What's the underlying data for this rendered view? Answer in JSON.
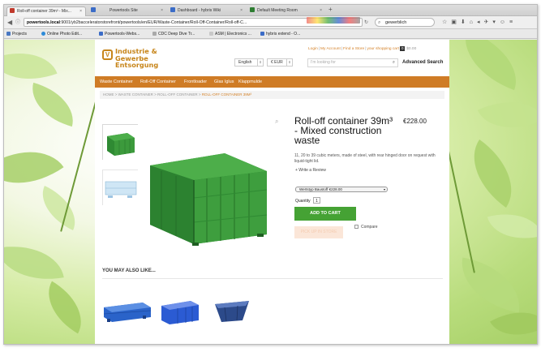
{
  "browser": {
    "tabs": [
      {
        "label": "Roll-off container 39m³ - Mix...",
        "icon_color": "#c0392b",
        "active": true
      },
      {
        "label": "Powertools Site",
        "icon_color": "#3b6cc7"
      },
      {
        "label": "Dashboard - hybris Wiki",
        "icon_color": "#3b6cc7"
      },
      {
        "label": "Default Meeting Room",
        "icon_color": "#2e7d32"
      }
    ],
    "url_host": "powertools.local",
    "url_path": ":9001/yb2bacceleratorstorefront/powertools/en/EUR/Waste-Container/Roll-Off-Container/Roll-off-C...",
    "search_value": "gewerblich",
    "bookmarks": [
      {
        "label": "Projects",
        "icon_color": "#4a78c2"
      },
      {
        "label": "Online Photo Edit...",
        "icon_color": "#2e8bd8"
      },
      {
        "label": "Powertools-Webs...",
        "icon_color": "#3b6cc7"
      },
      {
        "label": "CDC Deep Dive Tr...",
        "icon_color": "#aaa"
      },
      {
        "label": "ASM | Electronics ...",
        "icon_color": "#c8c8c8"
      },
      {
        "label": "hybris extend - O...",
        "icon_color": "#3b6cc7"
      }
    ]
  },
  "site": {
    "logo_line1": "Industrie & Gewerbe",
    "logo_line2": "Entsorgung",
    "logo_badge": "V",
    "language": "English",
    "currency": "€ EUR",
    "top_links": [
      "Login",
      "My Account",
      "Find a Store",
      "your shopping cart"
    ],
    "cart_count": "0",
    "cart_total": "$0.00",
    "search_placeholder": "I'm looking for",
    "advanced_search": "Advanced Search",
    "nav": [
      "Waste Container",
      "Roll-Off Container",
      "Frontloader",
      "Glas Iglus",
      "Klappmulde"
    ],
    "breadcrumb": {
      "trail": "HOME > WASTE CONTAINER > ROLL-OFF CONTAINER > ",
      "current": "ROLL-OFF CONTAINER 39M³"
    }
  },
  "product": {
    "title": "Roll-off container 39m³ - Mixed construction waste",
    "price": "€228.00",
    "description": "11, 20 to 39 cubic meters, made of steel, with rear hinged door on request with liquid-tight lid.",
    "review_link": "+ Write a Review",
    "variant_selected": "Wertstyp Baustoff €228.00",
    "quantity_label": "Quantity",
    "quantity_value": "1",
    "add_to_cart": "ADD TO CART",
    "compare_label": "Compare",
    "pickup_button": "PICK UP IN STORE",
    "body_color": "#3f9a3b",
    "thumb2_color": "#cfe6f5"
  },
  "related": {
    "heading": "YOU MAY ALSO LIKE...",
    "items": [
      {
        "name": "blue-flatbed-container",
        "color": "#2a63c9"
      },
      {
        "name": "blue-roll-off-container",
        "color": "#2b5bd3"
      },
      {
        "name": "blue-skip-container",
        "color": "#2c4a8a"
      }
    ]
  }
}
